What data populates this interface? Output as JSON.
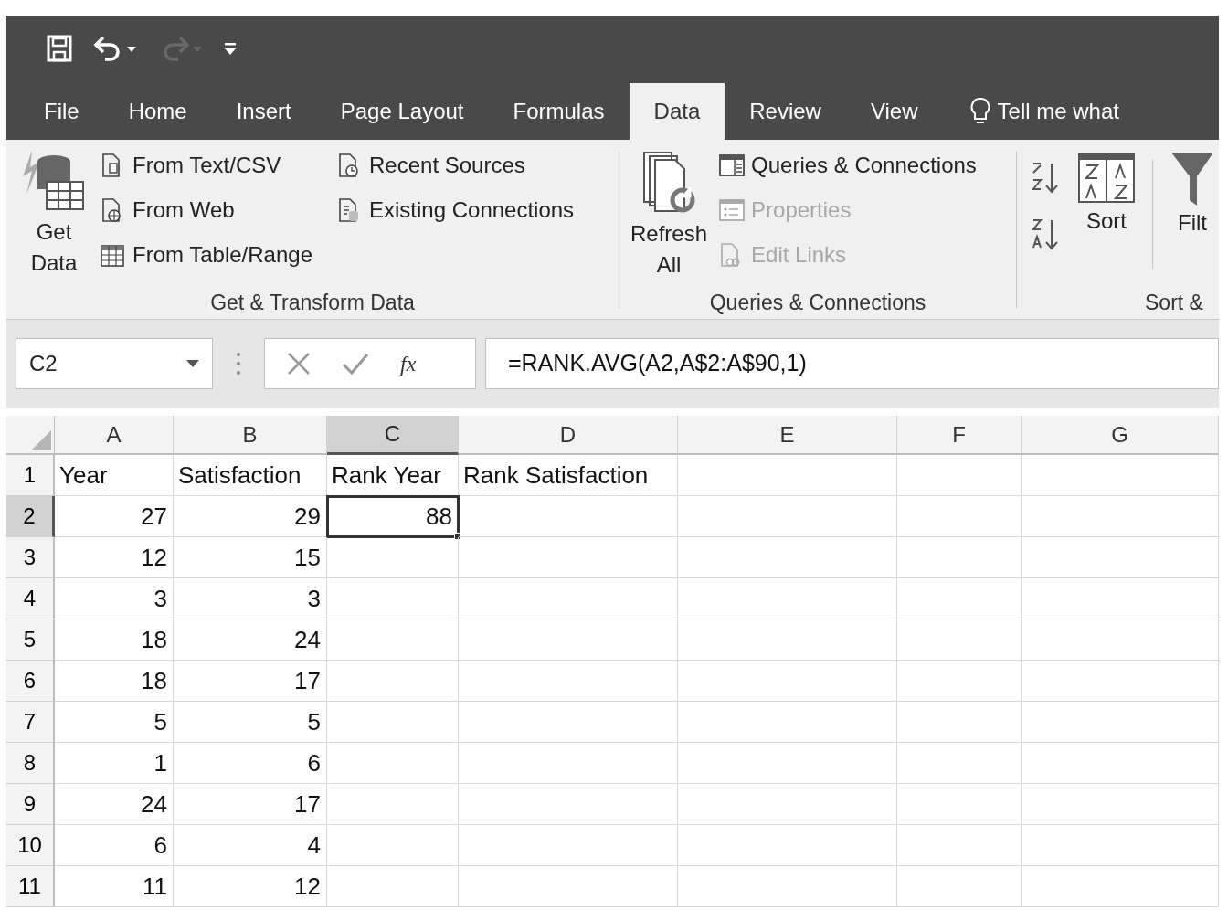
{
  "quick_access": [
    {
      "kind": "save",
      "disabled": false
    },
    {
      "kind": "undo",
      "disabled": false
    },
    {
      "kind": "redo",
      "disabled": true
    },
    {
      "kind": "customize",
      "disabled": false
    }
  ],
  "tabs": [
    {
      "label": "File",
      "selected": false
    },
    {
      "label": "Home",
      "selected": false
    },
    {
      "label": "Insert",
      "selected": false
    },
    {
      "label": "Page Layout",
      "selected": false
    },
    {
      "label": "Formulas",
      "selected": false
    },
    {
      "label": "Data",
      "selected": true
    },
    {
      "label": "Review",
      "selected": false
    },
    {
      "label": "View",
      "selected": false
    }
  ],
  "tell_me": "Tell me what",
  "ribbon": {
    "groups": [
      {
        "label": "Get & Transform Data",
        "large": [
          "Get",
          "Data"
        ],
        "items": [
          {
            "label": "From Text/CSV",
            "disabled": false
          },
          {
            "label": "From Web",
            "disabled": false
          },
          {
            "label": "From Table/Range",
            "disabled": false
          },
          {
            "label": "Recent Sources",
            "disabled": false
          },
          {
            "label": "Existing Connections",
            "disabled": false
          }
        ]
      },
      {
        "label": "Queries & Connections",
        "large": [
          "Refresh",
          "All"
        ],
        "items": [
          {
            "label": "Queries & Connections",
            "disabled": false
          },
          {
            "label": "Properties",
            "disabled": true
          },
          {
            "label": "Edit Links",
            "disabled": true
          }
        ]
      },
      {
        "label": "Sort &",
        "large": [
          "Sort"
        ],
        "items": [
          {
            "label": "Filt",
            "disabled": false
          }
        ]
      }
    ]
  },
  "formula_bar": {
    "name_box": "C2",
    "function_button": "fx",
    "formula": "=RANK.AVG(A2,A$2:A$90,1)"
  },
  "grid": {
    "columns": [
      {
        "label": "A",
        "selected": false
      },
      {
        "label": "B",
        "selected": false
      },
      {
        "label": "C",
        "selected": true
      },
      {
        "label": "D",
        "selected": false
      },
      {
        "label": "E",
        "selected": false
      },
      {
        "label": "F",
        "selected": false
      },
      {
        "label": "G",
        "selected": false
      }
    ],
    "rows": [
      {
        "header": "1",
        "selected": false,
        "kind": "text",
        "cells": [
          {
            "text": "Year",
            "selected": false
          },
          {
            "text": "Satisfaction",
            "selected": false
          },
          {
            "text": "Rank Year",
            "selected": false
          },
          {
            "text": "Rank Satisfaction",
            "selected": false
          }
        ]
      },
      {
        "header": "2",
        "selected": true,
        "kind": "number",
        "cells": [
          {
            "text": "27",
            "selected": false
          },
          {
            "text": "29",
            "selected": false
          },
          {
            "text": "88",
            "selected": true
          }
        ]
      },
      {
        "header": "3",
        "selected": false,
        "kind": "number",
        "cells": [
          {
            "text": "12",
            "selected": false
          },
          {
            "text": "15",
            "selected": false
          }
        ]
      },
      {
        "header": "4",
        "selected": false,
        "kind": "number",
        "cells": [
          {
            "text": "3",
            "selected": false
          },
          {
            "text": "3",
            "selected": false
          }
        ]
      },
      {
        "header": "5",
        "selected": false,
        "kind": "number",
        "cells": [
          {
            "text": "18",
            "selected": false
          },
          {
            "text": "24",
            "selected": false
          }
        ]
      },
      {
        "header": "6",
        "selected": false,
        "kind": "number",
        "cells": [
          {
            "text": "18",
            "selected": false
          },
          {
            "text": "17",
            "selected": false
          }
        ]
      },
      {
        "header": "7",
        "selected": false,
        "kind": "number",
        "cells": [
          {
            "text": "5",
            "selected": false
          },
          {
            "text": "5",
            "selected": false
          }
        ]
      },
      {
        "header": "8",
        "selected": false,
        "kind": "number",
        "cells": [
          {
            "text": "1",
            "selected": false
          },
          {
            "text": "6",
            "selected": false
          }
        ]
      },
      {
        "header": "9",
        "selected": false,
        "kind": "number",
        "cells": [
          {
            "text": "24",
            "selected": false
          },
          {
            "text": "17",
            "selected": false
          }
        ]
      },
      {
        "header": "10",
        "selected": false,
        "kind": "number",
        "cells": [
          {
            "text": "6",
            "selected": false
          },
          {
            "text": "4",
            "selected": false
          }
        ]
      },
      {
        "header": "11",
        "selected": false,
        "kind": "number",
        "cells": [
          {
            "text": "11",
            "selected": false
          },
          {
            "text": "12",
            "selected": false
          }
        ]
      }
    ]
  }
}
